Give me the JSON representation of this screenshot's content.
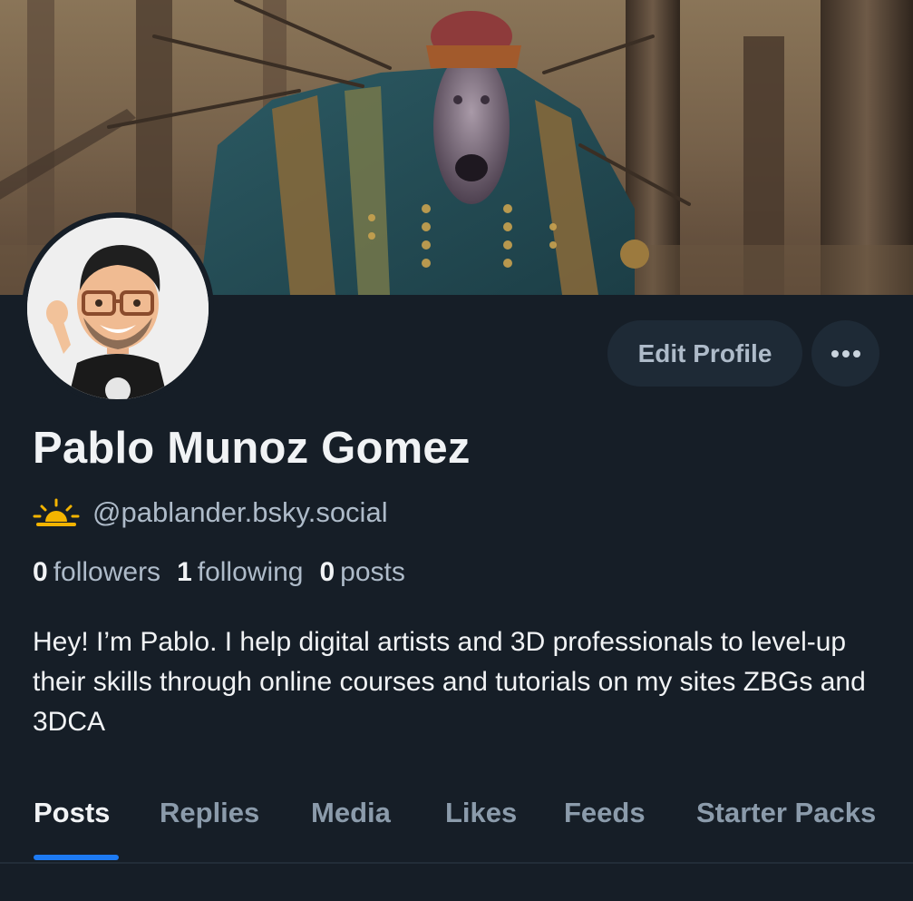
{
  "profile": {
    "display_name": "Pablo Munoz Gomez",
    "handle": "@pablander.bsky.social",
    "stats": [
      {
        "value": "0",
        "label": "followers"
      },
      {
        "value": "1",
        "label": "following"
      },
      {
        "value": "0",
        "label": "posts"
      }
    ],
    "bio": "Hey! I’m Pablo. I help digital artists and 3D professionals to level-up their skills through online courses and tutorials on my sites ZBGs and 3DCA"
  },
  "actions": {
    "edit_label": "Edit Profile",
    "more_icon": "ellipsis-icon"
  },
  "tabs": [
    {
      "label": "Posts",
      "active": true
    },
    {
      "label": "Replies",
      "active": false
    },
    {
      "label": "Media",
      "active": false
    },
    {
      "label": "Likes",
      "active": false
    },
    {
      "label": "Feeds",
      "active": false
    },
    {
      "label": "Starter Packs",
      "active": false
    }
  ],
  "colors": {
    "background": "#161e27",
    "accent": "#1d7af2",
    "muted_text": "#aebbc9",
    "button_bg": "#1e2a36"
  }
}
